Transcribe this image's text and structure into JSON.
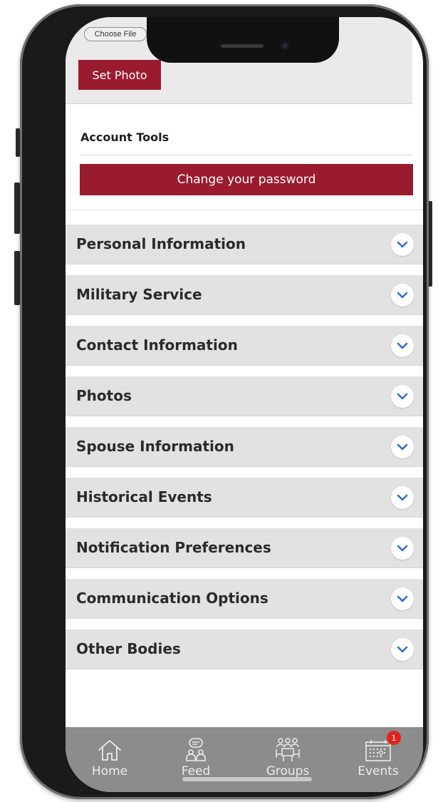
{
  "photo_section": {
    "choose_file_label": "Choose File",
    "set_photo_label": "Set Photo"
  },
  "account_tools": {
    "title": "Account Tools",
    "change_password_label": "Change your password"
  },
  "sections": [
    {
      "label": "Personal Information"
    },
    {
      "label": "Military Service"
    },
    {
      "label": "Contact Information"
    },
    {
      "label": "Photos"
    },
    {
      "label": "Spouse Information"
    },
    {
      "label": "Historical Events"
    },
    {
      "label": "Notification Preferences"
    },
    {
      "label": "Communication Options"
    },
    {
      "label": "Other Bodies"
    }
  ],
  "tabbar": {
    "tabs": [
      {
        "label": "Home",
        "icon": "home-icon"
      },
      {
        "label": "Feed",
        "icon": "feed-icon"
      },
      {
        "label": "Groups",
        "icon": "groups-icon"
      },
      {
        "label": "Events",
        "icon": "calendar-icon",
        "badge": "1"
      }
    ]
  },
  "colors": {
    "brand": "#9a1b2d",
    "section_bg": "#e2e2e2",
    "chevron": "#2f6fd1",
    "tabbar_bg": "#8c8c8c",
    "badge": "#e32222"
  }
}
